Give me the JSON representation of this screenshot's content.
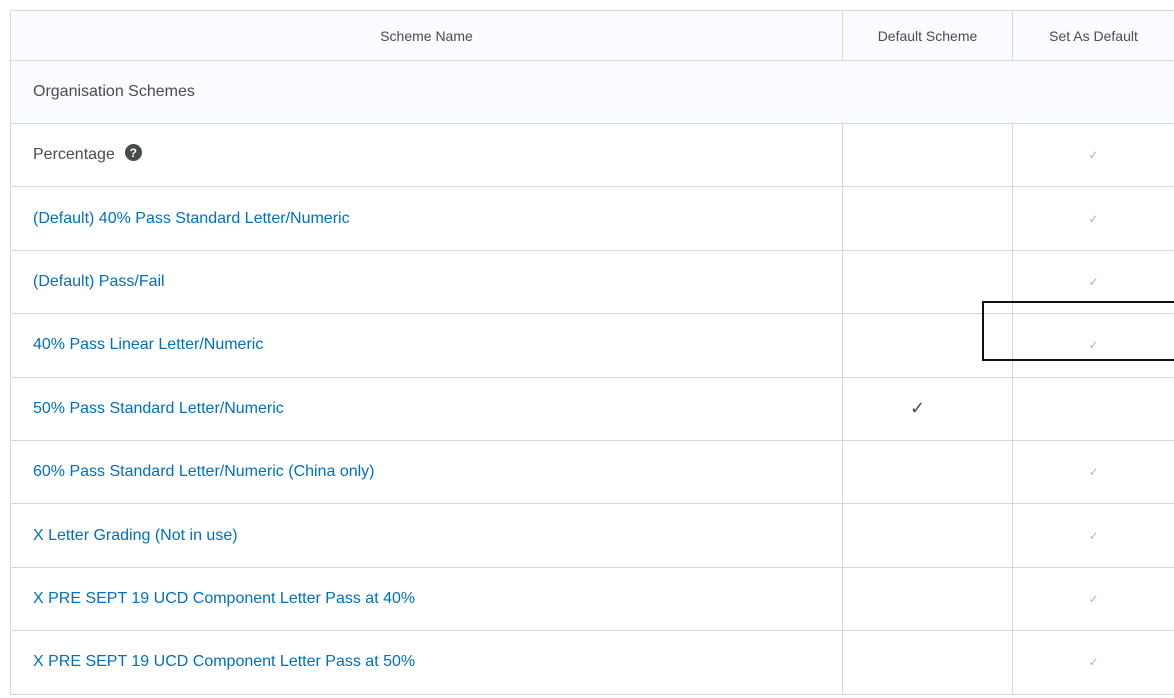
{
  "table": {
    "headers": {
      "scheme_name": "Scheme Name",
      "default_scheme": "Default Scheme",
      "set_as_default": "Set As Default"
    },
    "group_label": "Organisation Schemes",
    "check_glyph": "✓",
    "rows": [
      {
        "name": "Percentage",
        "is_link": false,
        "has_help_icon": true,
        "help_glyph": "?",
        "is_default": false,
        "set_default_available": true
      },
      {
        "name": "(Default) 40% Pass Standard Letter/Numeric",
        "is_link": true,
        "is_default": false,
        "set_default_available": true
      },
      {
        "name": "(Default) Pass/Fail",
        "is_link": true,
        "is_default": false,
        "set_default_available": true
      },
      {
        "name": "40% Pass Linear Letter/Numeric",
        "is_link": true,
        "is_default": false,
        "set_default_available": true,
        "highlighted": true
      },
      {
        "name": "50% Pass Standard Letter/Numeric",
        "is_link": true,
        "is_default": true,
        "set_default_available": false
      },
      {
        "name": "60% Pass Standard Letter/Numeric (China only)",
        "is_link": true,
        "is_default": false,
        "set_default_available": true
      },
      {
        "name": "X Letter Grading (Not in use)",
        "is_link": true,
        "is_default": false,
        "set_default_available": true
      },
      {
        "name": "X PRE SEPT 19 UCD Component Letter Pass at 40%",
        "is_link": true,
        "is_default": false,
        "set_default_available": true
      },
      {
        "name": "X PRE SEPT 19 UCD Component Letter Pass at 50%",
        "is_link": true,
        "is_default": false,
        "set_default_available": true
      }
    ]
  },
  "colors": {
    "link": "#006fbf",
    "text": "#494c4e",
    "border": "#d3d9e3",
    "header_bg": "#f9fbff",
    "check_muted": "#b0b4b8"
  },
  "icons": {
    "help": "question-circle-icon",
    "check": "checkmark-icon"
  }
}
